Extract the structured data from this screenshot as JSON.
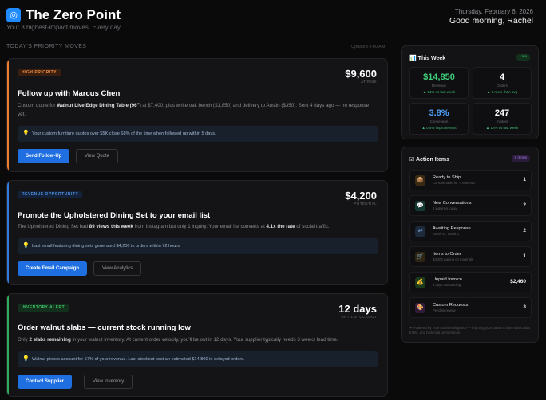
{
  "header": {
    "logo_glyph": "◎",
    "title": "The Zero Point",
    "subtitle": "Your 3 highest-impact moves. Every day.",
    "date": "Thursday, February 6, 2026",
    "greeting": "Good morning, Rachel"
  },
  "priority": {
    "section_label": "TODAY'S PRIORITY MOVES",
    "updated": "Updated 8:00 AM"
  },
  "cards": [
    {
      "badge": "HIGH PRIORITY",
      "metric_value": "$9,600",
      "metric_label": "AT RISK",
      "title": "Follow up with Marcus Chen",
      "desc_1": "Custom quote for ",
      "desc_bold_1": "Walnut Live Edge Dining Table (96\")",
      "desc_2": " at $7,400, plus white oak bench ($1,850) and delivery to Austin ($350). Sent 4 days ago — no response yet.",
      "insight": "Your custom furniture quotes over $5K close 68% of the time when followed up within 5 days.",
      "primary": "Send Follow-Up",
      "secondary": "View Quote",
      "accent": "#f07b2a"
    },
    {
      "badge": "REVENUE OPPORTUNITY",
      "metric_value": "$4,200",
      "metric_label": "POTENTIAL",
      "title": "Promote the Upholstered Dining Set to your email list",
      "desc_1": "The Upholstered Dining Set had ",
      "desc_bold_1": "89 views this week",
      "desc_2": " from Instagram but only 1 inquiry. Your email list converts at ",
      "desc_bold_2": "4.1x the rate",
      "desc_3": " of social traffic.",
      "insight": "Last email featuring dining sets generated $4,200 in orders within 72 hours.",
      "primary": "Create Email Campaign",
      "secondary": "View Analytics",
      "accent": "#2f7de0"
    },
    {
      "badge": "INVENTORY ALERT",
      "metric_value": "12 days",
      "metric_label": "UNTIL STOCKOUT",
      "title": "Order walnut slabs — current stock running low",
      "desc_1": "Only ",
      "desc_bold_1": "2 slabs remaining",
      "desc_2": " in your walnut inventory. At current order velocity, you'll be out in 12 days. Your supplier typically needs 3 weeks lead time.",
      "insight": "Walnut pieces account for 57% of your revenue. Last stockout cost an estimated $14,800 in delayed orders.",
      "primary": "Contact Supplier",
      "secondary": "View Inventory",
      "accent": "#2fae5a"
    }
  ],
  "this_week": {
    "title": "This Week",
    "live": "Live",
    "stats": [
      {
        "value": "$14,850",
        "label": "Revenue",
        "change": "▲ 21% vs last week",
        "color": "#3fcf7a"
      },
      {
        "value": "4",
        "label": "Orders",
        "change": "▲ 1 more than avg",
        "color": "#ffffff"
      },
      {
        "value": "3.8%",
        "label": "Conversion",
        "change": "▲ 0.4% improvement",
        "color": "#4ea3ff"
      },
      {
        "value": "247",
        "label": "Visitors",
        "change": "▲ 12% vs last week",
        "color": "#ffffff"
      }
    ]
  },
  "action_items": {
    "title": "Action Items",
    "count_badge": "6 items",
    "items": [
      {
        "icon": "box-icon",
        "glyph": "📦",
        "title": "Ready to Ship",
        "sub": "Console table for T. Martinez",
        "count": "1",
        "bg": "#3a2a14"
      },
      {
        "icon": "chat-icon",
        "glyph": "💬",
        "title": "New Conversations",
        "sub": "2 inquiries today",
        "count": "2",
        "bg": "#143a34"
      },
      {
        "icon": "reply-icon",
        "glyph": "↩",
        "title": "Awaiting Response",
        "sub": "Sarah K., David L.",
        "count": "2",
        "bg": "#1c2a3a"
      },
      {
        "icon": "cart-icon",
        "glyph": "🛒",
        "title": "Items to Order",
        "sub": "$3,200 waiting on materials",
        "count": "1",
        "bg": "#2e2414"
      },
      {
        "icon": "money-icon",
        "glyph": "💰",
        "title": "Unpaid Invoice",
        "sub": "3 days outstanding",
        "count": "$2,460",
        "bg": "#1c3a1c"
      },
      {
        "icon": "palette-icon",
        "glyph": "🎨",
        "title": "Custom Requests",
        "sub": "Pending review",
        "count": "3",
        "bg": "#2e1c3a"
      }
    ],
    "footnote": "Powered by True North intelligence — learning your patterns from sales data, traffic, and historical performance."
  }
}
